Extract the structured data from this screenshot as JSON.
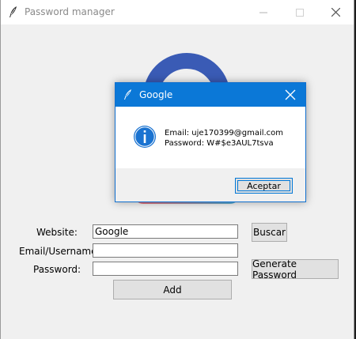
{
  "window": {
    "title": "Password manager",
    "icons": [
      "feather-icon",
      "minimize-icon",
      "maximize-icon",
      "close-icon"
    ]
  },
  "logo": {
    "icon": "padlock-logo",
    "colors": {
      "shackle": "#3a5bb5",
      "body": "#e86a73"
    }
  },
  "form": {
    "website_label": "Website:",
    "website_value": "Google",
    "email_label": "Email/Username:",
    "email_value": "",
    "password_label": "Password:",
    "password_value": "",
    "search_button": "Buscar",
    "generate_button": "Generate Password",
    "add_button": "Add"
  },
  "dialog": {
    "title": "Google",
    "icon": "info-icon",
    "email_line": "Email: uje170399@gmail.com",
    "password_line": "Password: W#$e3AUL7tsva",
    "ok_button": "Aceptar",
    "accent": "#0b78d7"
  }
}
